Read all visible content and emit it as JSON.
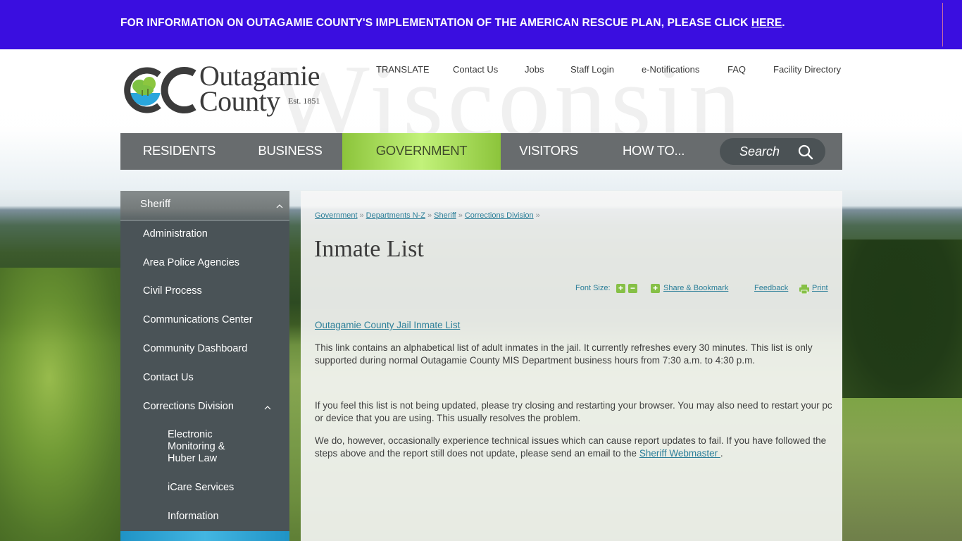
{
  "alert": {
    "text": "FOR INFORMATION ON OUTAGAMIE COUNTY'S IMPLEMENTATION OF THE AMERICAN RESCUE PLAN, PLEASE CLICK ",
    "link_label": "HERE",
    "suffix": ".",
    "bg_color": "#3a0ee0"
  },
  "header": {
    "watermark": "Wisconsin",
    "logo": {
      "line1": "Outagamie",
      "line2": "County",
      "est": "Est. 1851"
    }
  },
  "utility_nav": [
    {
      "label": "TRANSLATE"
    },
    {
      "label": "Contact Us"
    },
    {
      "label": "Jobs"
    },
    {
      "label": "Staff Login"
    },
    {
      "label": "e-Notifications"
    },
    {
      "label": "FAQ"
    },
    {
      "label": "Facility Directory"
    }
  ],
  "main_nav": {
    "items": [
      {
        "label": "RESIDENTS",
        "active": false
      },
      {
        "label": "BUSINESS",
        "active": false
      },
      {
        "label": "GOVERNMENT",
        "active": true
      },
      {
        "label": "VISITORS",
        "active": false
      },
      {
        "label": "HOW TO...",
        "active": false
      }
    ],
    "search_placeholder": "Search",
    "active_color": "#a4dc5a"
  },
  "sidebar": {
    "header": "Sheriff",
    "items": [
      {
        "label": "Administration"
      },
      {
        "label": "Area Police Agencies"
      },
      {
        "label": "Civil Process"
      },
      {
        "label": "Communications Center"
      },
      {
        "label": "Community Dashboard"
      },
      {
        "label": "Contact Us"
      },
      {
        "label": "Corrections Division",
        "expanded": true
      }
    ],
    "sub_items": [
      {
        "label": "Electronic Monitoring & Huber Law"
      },
      {
        "label": "iCare Services"
      },
      {
        "label": "Information"
      }
    ]
  },
  "content": {
    "breadcrumb": [
      {
        "label": "Government"
      },
      {
        "label": "Departments N-Z"
      },
      {
        "label": "Sheriff"
      },
      {
        "label": "Corrections Division"
      }
    ],
    "breadcrumb_sep": "»",
    "title": "Inmate List",
    "tools": {
      "font_size_label": "Font Size:",
      "increase": "+",
      "decrease": "−",
      "share_label": "Share & Bookmark",
      "feedback_label": "Feedback",
      "print_label": "Print"
    },
    "inmate_link": "Outagamie County Jail Inmate List",
    "para1": "This link contains an alphabetical list of adult inmates in the jail.  It currently refreshes every 30 minutes.  This list is only supported during normal Outagamie County MIS Department business hours from 7:30 a.m. to 4:30 p.m.",
    "para2": "If you feel this list is not being updated, please try closing and restarting your browser.  You may also need to restart your pc or device that you are using.  This usually resolves the problem.",
    "para3_prefix": "We do, however, occasionally experience technical issues which can cause report updates to fail.  If you have followed the steps above and the report still does not update, please send an email to the ",
    "para3_link": "Sheriff Webmaster ",
    "para3_suffix": "."
  }
}
